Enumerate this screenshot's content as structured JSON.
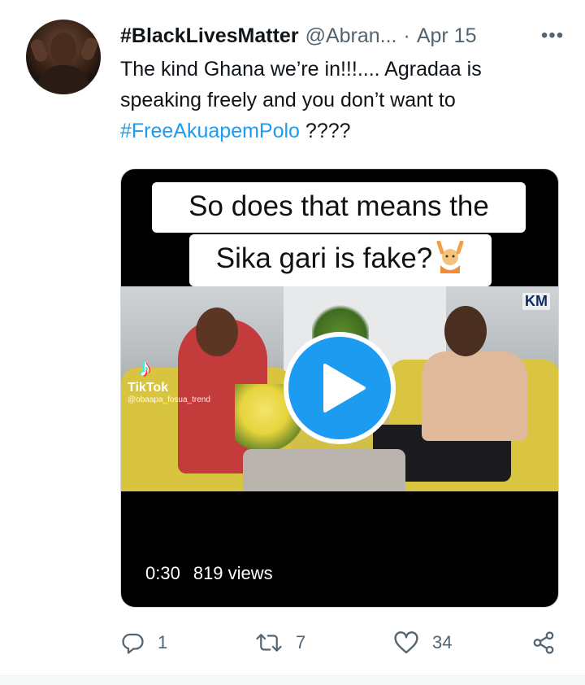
{
  "tweet": {
    "display_name": "#BlackLivesMatter",
    "handle": "@Abran...",
    "separator": "·",
    "date": "Apr 15",
    "more_label": "•••",
    "text_part1": "The kind Ghana we’re in!!!.... Agradaa is speaking freely and you don’t want to ",
    "hashtag": "#FreeAkuapemPolo",
    "text_part2": " ????"
  },
  "media": {
    "caption_line1": "So does that means the",
    "caption_line2": "Sika gari is fake?",
    "watermark_brand": "TikTok",
    "watermark_user": "@obaapa_fosua_trend",
    "channel_logo": "KM",
    "duration": "0:30",
    "views": "819 views"
  },
  "actions": {
    "replies": "1",
    "retweets": "7",
    "likes": "34"
  },
  "colors": {
    "accent": "#1d9bf0",
    "muted": "#536471",
    "text": "#0f1419"
  },
  "icons": [
    "more-icon",
    "play-icon",
    "reply-icon",
    "retweet-icon",
    "like-icon",
    "share-icon",
    "tiktok-icon",
    "raising-hands-emoji"
  ]
}
